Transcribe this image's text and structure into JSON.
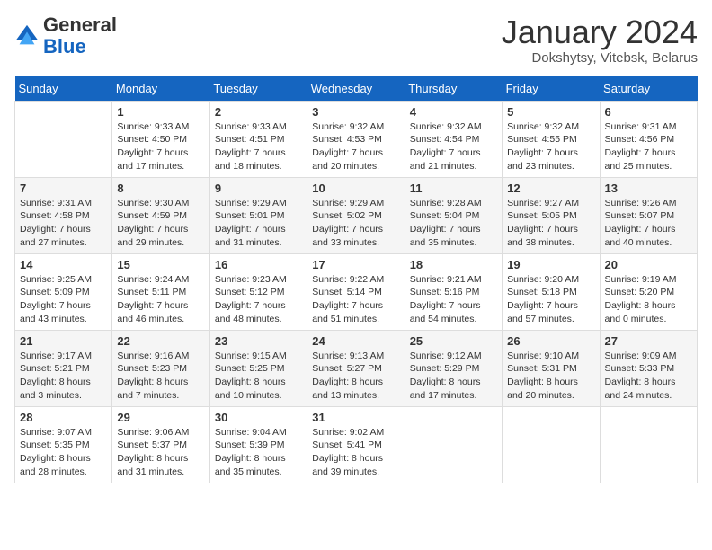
{
  "header": {
    "logo": {
      "general": "General",
      "blue": "Blue"
    },
    "title": "January 2024",
    "subtitle": "Dokshytsy, Vitebsk, Belarus"
  },
  "days_of_week": [
    "Sunday",
    "Monday",
    "Tuesday",
    "Wednesday",
    "Thursday",
    "Friday",
    "Saturday"
  ],
  "weeks": [
    [
      {
        "day": "",
        "info": ""
      },
      {
        "day": "1",
        "info": "Sunrise: 9:33 AM\nSunset: 4:50 PM\nDaylight: 7 hours\nand 17 minutes."
      },
      {
        "day": "2",
        "info": "Sunrise: 9:33 AM\nSunset: 4:51 PM\nDaylight: 7 hours\nand 18 minutes."
      },
      {
        "day": "3",
        "info": "Sunrise: 9:32 AM\nSunset: 4:53 PM\nDaylight: 7 hours\nand 20 minutes."
      },
      {
        "day": "4",
        "info": "Sunrise: 9:32 AM\nSunset: 4:54 PM\nDaylight: 7 hours\nand 21 minutes."
      },
      {
        "day": "5",
        "info": "Sunrise: 9:32 AM\nSunset: 4:55 PM\nDaylight: 7 hours\nand 23 minutes."
      },
      {
        "day": "6",
        "info": "Sunrise: 9:31 AM\nSunset: 4:56 PM\nDaylight: 7 hours\nand 25 minutes."
      }
    ],
    [
      {
        "day": "7",
        "info": "Sunrise: 9:31 AM\nSunset: 4:58 PM\nDaylight: 7 hours\nand 27 minutes."
      },
      {
        "day": "8",
        "info": "Sunrise: 9:30 AM\nSunset: 4:59 PM\nDaylight: 7 hours\nand 29 minutes."
      },
      {
        "day": "9",
        "info": "Sunrise: 9:29 AM\nSunset: 5:01 PM\nDaylight: 7 hours\nand 31 minutes."
      },
      {
        "day": "10",
        "info": "Sunrise: 9:29 AM\nSunset: 5:02 PM\nDaylight: 7 hours\nand 33 minutes."
      },
      {
        "day": "11",
        "info": "Sunrise: 9:28 AM\nSunset: 5:04 PM\nDaylight: 7 hours\nand 35 minutes."
      },
      {
        "day": "12",
        "info": "Sunrise: 9:27 AM\nSunset: 5:05 PM\nDaylight: 7 hours\nand 38 minutes."
      },
      {
        "day": "13",
        "info": "Sunrise: 9:26 AM\nSunset: 5:07 PM\nDaylight: 7 hours\nand 40 minutes."
      }
    ],
    [
      {
        "day": "14",
        "info": "Sunrise: 9:25 AM\nSunset: 5:09 PM\nDaylight: 7 hours\nand 43 minutes."
      },
      {
        "day": "15",
        "info": "Sunrise: 9:24 AM\nSunset: 5:11 PM\nDaylight: 7 hours\nand 46 minutes."
      },
      {
        "day": "16",
        "info": "Sunrise: 9:23 AM\nSunset: 5:12 PM\nDaylight: 7 hours\nand 48 minutes."
      },
      {
        "day": "17",
        "info": "Sunrise: 9:22 AM\nSunset: 5:14 PM\nDaylight: 7 hours\nand 51 minutes."
      },
      {
        "day": "18",
        "info": "Sunrise: 9:21 AM\nSunset: 5:16 PM\nDaylight: 7 hours\nand 54 minutes."
      },
      {
        "day": "19",
        "info": "Sunrise: 9:20 AM\nSunset: 5:18 PM\nDaylight: 7 hours\nand 57 minutes."
      },
      {
        "day": "20",
        "info": "Sunrise: 9:19 AM\nSunset: 5:20 PM\nDaylight: 8 hours\nand 0 minutes."
      }
    ],
    [
      {
        "day": "21",
        "info": "Sunrise: 9:17 AM\nSunset: 5:21 PM\nDaylight: 8 hours\nand 3 minutes."
      },
      {
        "day": "22",
        "info": "Sunrise: 9:16 AM\nSunset: 5:23 PM\nDaylight: 8 hours\nand 7 minutes."
      },
      {
        "day": "23",
        "info": "Sunrise: 9:15 AM\nSunset: 5:25 PM\nDaylight: 8 hours\nand 10 minutes."
      },
      {
        "day": "24",
        "info": "Sunrise: 9:13 AM\nSunset: 5:27 PM\nDaylight: 8 hours\nand 13 minutes."
      },
      {
        "day": "25",
        "info": "Sunrise: 9:12 AM\nSunset: 5:29 PM\nDaylight: 8 hours\nand 17 minutes."
      },
      {
        "day": "26",
        "info": "Sunrise: 9:10 AM\nSunset: 5:31 PM\nDaylight: 8 hours\nand 20 minutes."
      },
      {
        "day": "27",
        "info": "Sunrise: 9:09 AM\nSunset: 5:33 PM\nDaylight: 8 hours\nand 24 minutes."
      }
    ],
    [
      {
        "day": "28",
        "info": "Sunrise: 9:07 AM\nSunset: 5:35 PM\nDaylight: 8 hours\nand 28 minutes."
      },
      {
        "day": "29",
        "info": "Sunrise: 9:06 AM\nSunset: 5:37 PM\nDaylight: 8 hours\nand 31 minutes."
      },
      {
        "day": "30",
        "info": "Sunrise: 9:04 AM\nSunset: 5:39 PM\nDaylight: 8 hours\nand 35 minutes."
      },
      {
        "day": "31",
        "info": "Sunrise: 9:02 AM\nSunset: 5:41 PM\nDaylight: 8 hours\nand 39 minutes."
      },
      {
        "day": "",
        "info": ""
      },
      {
        "day": "",
        "info": ""
      },
      {
        "day": "",
        "info": ""
      }
    ]
  ]
}
